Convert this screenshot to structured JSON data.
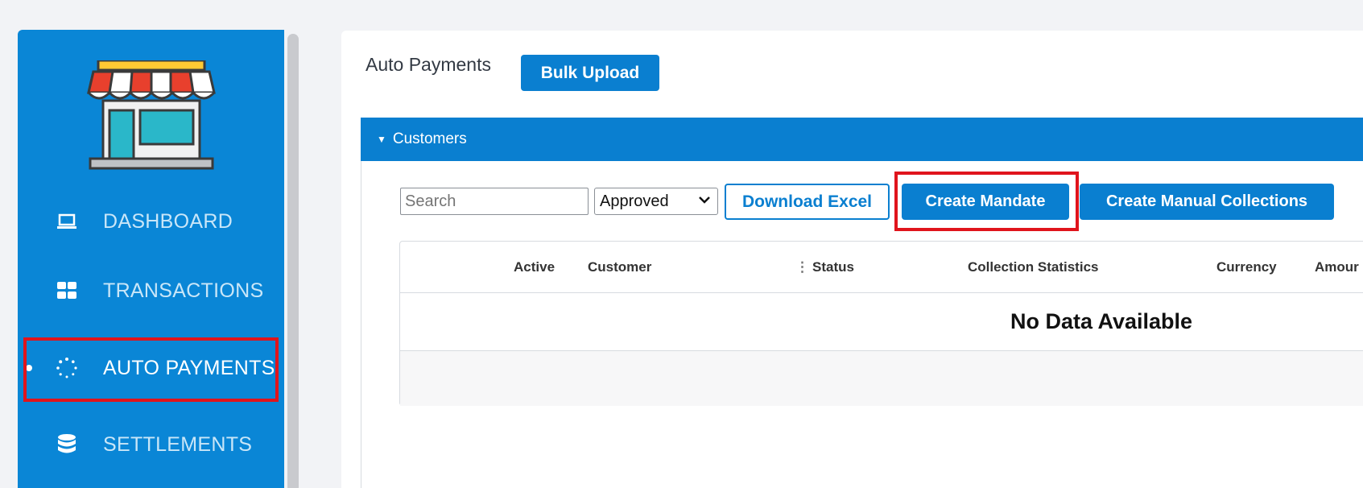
{
  "sidebar": {
    "items": [
      {
        "label": "DASHBOARD",
        "icon": "laptop-icon"
      },
      {
        "label": "TRANSACTIONS",
        "icon": "grid-icon"
      },
      {
        "label": "AUTO PAYMENTS",
        "icon": "spinner-icon",
        "active": true
      },
      {
        "label": "SETTLEMENTS",
        "icon": "database-icon"
      }
    ],
    "logo": "storefront-logo"
  },
  "main": {
    "title": "Auto Payments",
    "bulk_upload_label": "Bulk Upload",
    "section_title": "Customers",
    "search_placeholder": "Search",
    "status_filter": "Approved",
    "download_excel_label": "Download Excel",
    "create_mandate_label": "Create Mandate",
    "create_manual_label": "Create Manual Collections",
    "table": {
      "columns": [
        "Active",
        "Customer",
        "Status",
        "Collection Statistics",
        "Currency",
        "Amour"
      ],
      "empty_message": "No Data Available"
    }
  },
  "colors": {
    "accent": "#0a7fd0",
    "sidebar": "#0a86d6",
    "highlight": "#e0141c"
  }
}
